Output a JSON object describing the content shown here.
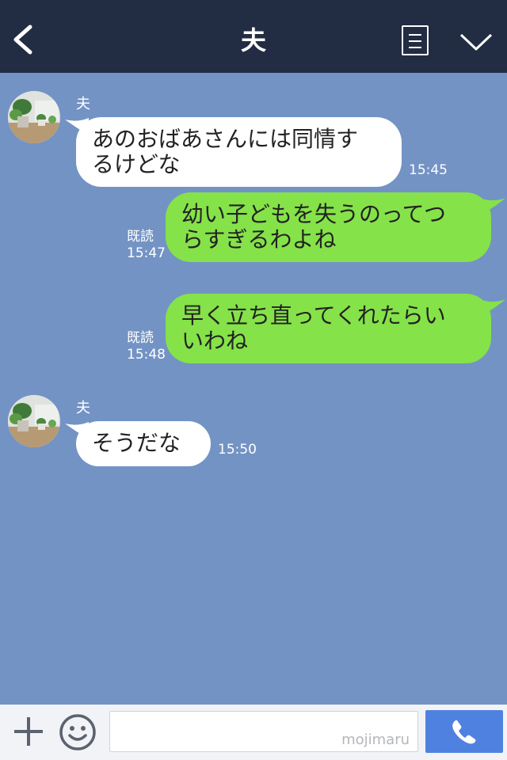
{
  "header": {
    "title": "夫"
  },
  "messages": [
    {
      "sender": "夫",
      "lines": [
        "あのおばあさんには同情す",
        "るけどな"
      ],
      "time": "15:45"
    },
    {
      "read": "既読",
      "lines": [
        "幼い子どもを失うのってつ",
        "らすぎるわよね"
      ],
      "time": "15:47"
    },
    {
      "read": "既読",
      "lines": [
        "早く立ち直ってくれたらい",
        "いわね"
      ],
      "time": "15:48"
    },
    {
      "sender": "夫",
      "lines": [
        "そうだな"
      ],
      "time": "15:50"
    }
  ],
  "footer": {
    "watermark": "mojimaru"
  },
  "colors": {
    "header": "#222c43",
    "background": "#7393c4",
    "incoming_bubble": "#ffffff",
    "outgoing_bubble": "#85e249",
    "call_button": "#4f82e0"
  },
  "icons": [
    "back-icon",
    "menu-icon",
    "chevron-down-icon",
    "plus-icon",
    "smile-icon",
    "phone-icon"
  ]
}
